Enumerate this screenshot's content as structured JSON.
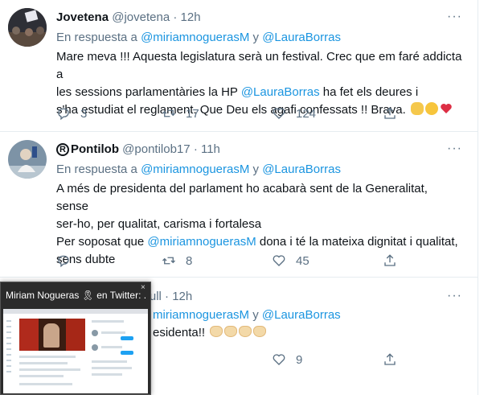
{
  "tweets": [
    {
      "name": "Jovetena",
      "handle": "@jovetena",
      "dot": "·",
      "time": "12h",
      "reply_prefix": "En respuesta a",
      "mention1": "@miriamnoguerasM",
      "reply_and": "y",
      "mention2": "@LauraBorras",
      "text_line1": "Mare meva !!! Aquesta legislatura serà un festival. Crec que em faré addicta a",
      "text_line2a": "les sessions parlamentàries  la HP ",
      "text_line2_mention": "@LauraBorras",
      "text_line2b": " ha fet els deures i",
      "text_line3": "s'ha estudiat el reglament. Que Deu els agafi confessats !! Brava.",
      "emojis": [
        "ok-hand-emoji",
        "smiling-face-emoji",
        "red-heart-emoji"
      ],
      "replies": "3",
      "retweets": "17",
      "likes": "124"
    },
    {
      "name": "Pontilob",
      "name_symbol": "R",
      "handle": "@pontilob17",
      "dot": "·",
      "time": "11h",
      "reply_prefix": "En respuesta a",
      "mention1": "@miriamnoguerasM",
      "reply_and": "y",
      "mention2": "@LauraBorras",
      "text_line1": "A més de presidenta del parlament ho acabarà sent de la Generalitat, sense",
      "text_line2": "ser-ho, per qualitat, carisma i fortalesa",
      "text_line3a": "Per soposat que ",
      "text_line3_mention": "@miriamnoguerasM",
      "text_line3b": " dona i té la mateixa dignitat i qualitat,",
      "text_line4": "sens dubte",
      "replies": "",
      "retweets": "8",
      "likes": "45"
    },
    {
      "handle_visible": "ofarull",
      "dot": "·",
      "time": "12h",
      "mention1": "miriamnoguerasM",
      "reply_and": "y",
      "mention2": "@LauraBorras",
      "text": "esidenta!!",
      "emojis": [
        "clapping-hands-emoji",
        "clapping-hands-emoji",
        "clapping-hands-emoji",
        "clapping-hands-emoji"
      ],
      "likes": "9"
    }
  ],
  "taskbar_thumbnail": {
    "title": "Miriam Nogueras 🎗 en Twitter: ...",
    "close": "×"
  },
  "colors": {
    "link": "#1b95e0",
    "secondary_text": "#5b7083",
    "heart_red": "#e0245e"
  }
}
